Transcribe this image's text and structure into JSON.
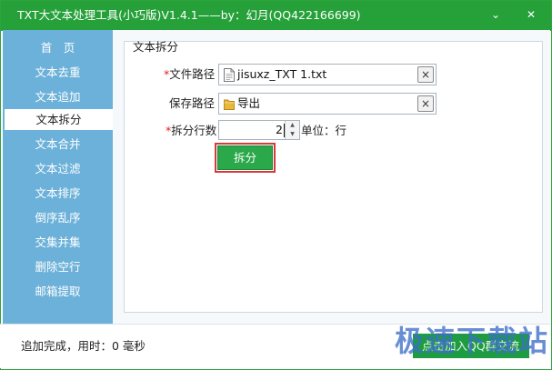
{
  "window": {
    "title": "TXT大文本处理工具(小巧版)V1.4.1——by：幻月(QQ422166699)",
    "menu_glyph": "⌄",
    "close_glyph": "✕"
  },
  "sidebar": {
    "items": [
      {
        "label": "首　页"
      },
      {
        "label": "文本去重"
      },
      {
        "label": "文本追加"
      },
      {
        "label": "文本拆分"
      },
      {
        "label": "文本合并"
      },
      {
        "label": "文本过滤"
      },
      {
        "label": "文本排序"
      },
      {
        "label": "倒序乱序"
      },
      {
        "label": "交集并集"
      },
      {
        "label": "删除空行"
      },
      {
        "label": "邮箱提取"
      }
    ],
    "active_index": 3
  },
  "panel": {
    "title": "文本拆分",
    "file_path": {
      "required_mark": "*",
      "label": "文件路径",
      "value": "jisuxz_TXT 1.txt",
      "icon": "file-icon"
    },
    "save_path": {
      "label": "保存路径",
      "value": "导出",
      "icon": "folder-icon"
    },
    "split_lines": {
      "required_mark": "*",
      "label": "拆分行数",
      "value": "2",
      "unit": "单位：行"
    },
    "clear_glyph": "×",
    "split_button": "拆分"
  },
  "status": {
    "text": "追加完成，用时：0 毫秒",
    "qq_button": "点击加入QQ群交流"
  },
  "watermark": {
    "text": "极速下载站"
  },
  "colors": {
    "titlebar": "#26a13a",
    "sidebar": "#6cb1d9",
    "button": "#2aa84a",
    "highlight": "#d33a3a"
  }
}
